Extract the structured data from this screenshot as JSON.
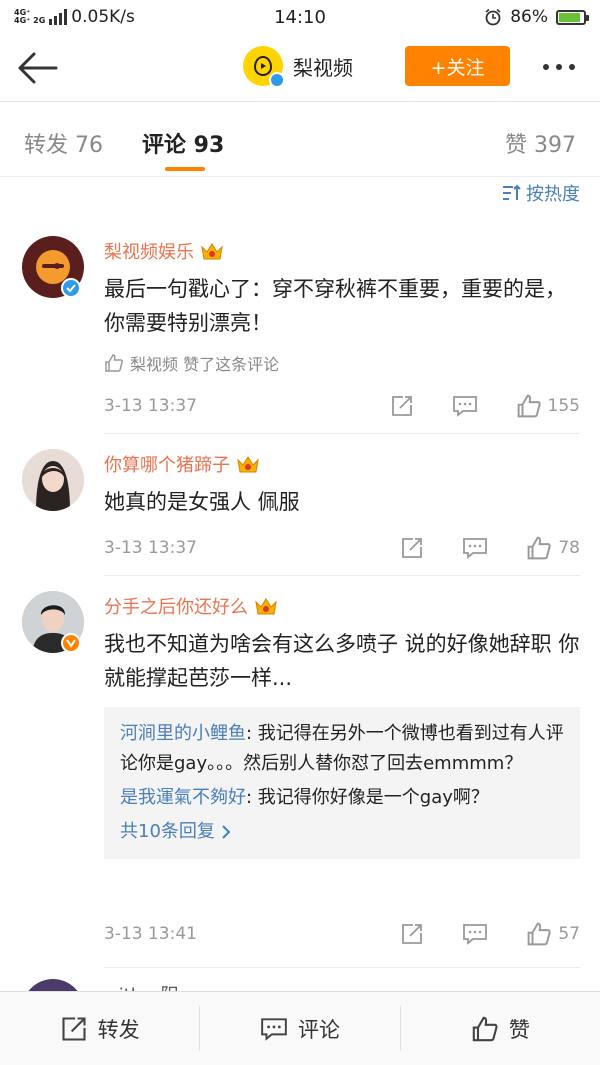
{
  "status": {
    "network_top": "4G⁺",
    "network_bottom": "4G⁺ 2G",
    "speed": "0.05K/s",
    "time": "14:10",
    "battery": "86%",
    "battery_level": 0.86
  },
  "nav": {
    "title": "梨视频",
    "follow_label": "+关注"
  },
  "tabs": {
    "repost": "转发 76",
    "comments": "评论 93",
    "likes": "赞 397"
  },
  "sort_label": "按热度",
  "comments": [
    {
      "user": "梨视频娱乐",
      "text": "最后一句戳心了：穿不穿秋裤不重要，重要的是，你需要特别漂亮！",
      "liked_by": "梨视频 赞了这条评论",
      "time": "3-13 13:37",
      "likes": "155"
    },
    {
      "user": "你算哪个猪蹄子",
      "text": "她真的是女强人 佩服",
      "time": "3-13 13:37",
      "likes": "78"
    },
    {
      "user": "分手之后你还好么",
      "text": "我也不知道为啥会有这么多喷子 说的好像她辞职 你就能撑起芭莎一样...",
      "replies": [
        {
          "name": "河涧里的小鲤鱼",
          "text": ": 我记得在另外一个微博也看到过有人评论你是gay。。。然后别人替你怼了回去emmmm？"
        },
        {
          "name": "是我運氣不夠好",
          "text": ": 我记得你好像是一个gay啊？"
        }
      ],
      "more_replies": "共10条回复",
      "time": "3-13 13:41",
      "likes": "57"
    },
    {
      "user": "withor阳"
    }
  ],
  "bottom": {
    "repost": "转发",
    "comment": "评论",
    "like": "赞"
  },
  "colors": {
    "accent": "#ff8200",
    "username": "#eb7350",
    "link": "#4a7fb8",
    "verified_blue": "#2d9bea",
    "verified_orange": "#ff8200"
  }
}
